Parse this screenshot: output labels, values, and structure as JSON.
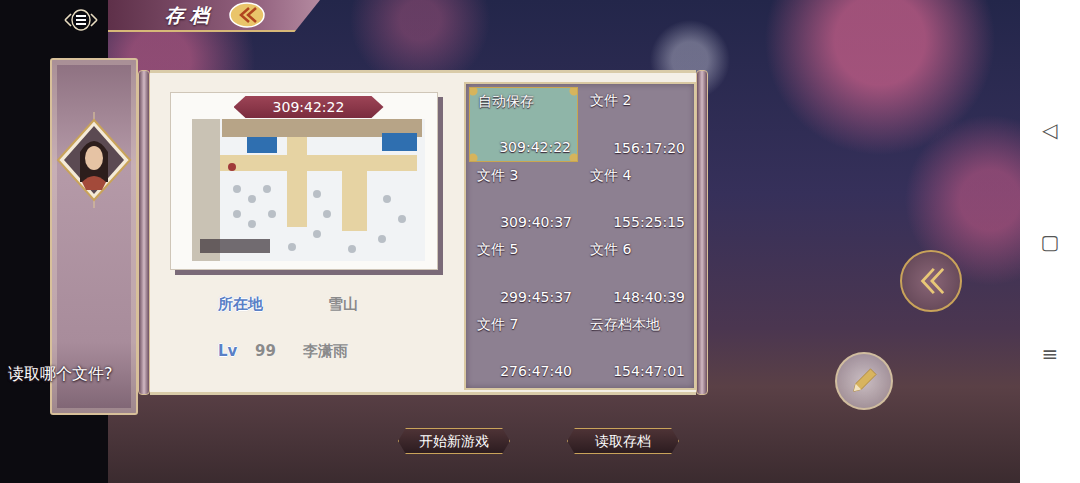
{
  "header": {
    "title": "存档"
  },
  "prompt": "读取哪个文件?",
  "preview": {
    "time": "309:42:22",
    "location_label": "所在地",
    "location": "雪山",
    "level_label": "Lv",
    "level": "99",
    "character": "李潇雨"
  },
  "slots": [
    {
      "label": "自动保存",
      "time": "309:42:22",
      "selected": true
    },
    {
      "label": "文件 2",
      "time": "156:17:20",
      "selected": false
    },
    {
      "label": "文件 3",
      "time": "309:40:37",
      "selected": false
    },
    {
      "label": "文件 4",
      "time": "155:25:15",
      "selected": false
    },
    {
      "label": "文件 5",
      "time": "299:45:37",
      "selected": false
    },
    {
      "label": "文件 6",
      "time": "148:40:39",
      "selected": false
    },
    {
      "label": "文件 7",
      "time": "276:47:40",
      "selected": false
    },
    {
      "label": "云存档本地",
      "time": "154:47:01",
      "selected": false
    }
  ],
  "buttons": [
    {
      "label": "开始新游戏"
    },
    {
      "label": "读取存档"
    }
  ],
  "nav_bar": [
    "◁",
    "▢",
    "≡"
  ]
}
